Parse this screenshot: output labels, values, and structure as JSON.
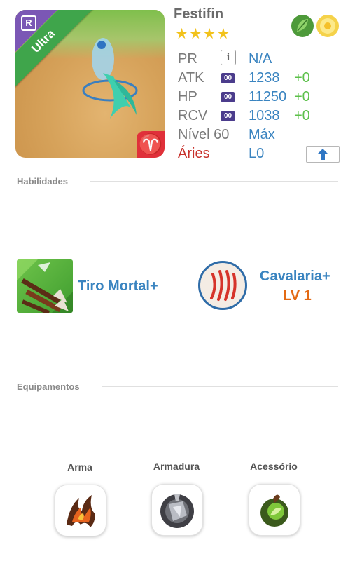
{
  "monster": {
    "name": "Festifin",
    "stars": "★★★★",
    "rarity_label": "Ultra",
    "rarity_letter": "R",
    "sign_symbol": "♈",
    "attributes": [
      "leaf-icon",
      "light-flower-icon"
    ]
  },
  "stats": [
    {
      "label": "PR",
      "value": "N/A",
      "plus": ""
    },
    {
      "label": "ATK",
      "boost": "00",
      "value": "1238",
      "plus": "+0"
    },
    {
      "label": "HP",
      "boost": "00",
      "value": "11250",
      "plus": "+0"
    },
    {
      "label": "RCV",
      "boost": "00",
      "value": "1038",
      "plus": "+0"
    }
  ],
  "level": {
    "label": "Nível 60",
    "value": "Máx"
  },
  "sign": {
    "label": "Áries",
    "value": "L0"
  },
  "colors": {
    "value_blue": "#3a84c0",
    "plus_green": "#5cc04a",
    "sign_red": "#c8322c",
    "lv_orange": "#e36a14"
  },
  "sections": {
    "abilities": "Habilidades",
    "equipment": "Equipamentos"
  },
  "skills": {
    "active_name": "Tiro Mortal+",
    "leader_name": "Cavalaria+",
    "leader_level": "LV 1"
  },
  "equipment": [
    {
      "label": "Arma",
      "icon": "flame-claw-icon"
    },
    {
      "label": "Armadura",
      "icon": "stone-shield-icon"
    },
    {
      "label": "Acessório",
      "icon": "green-orb-icon"
    }
  ]
}
